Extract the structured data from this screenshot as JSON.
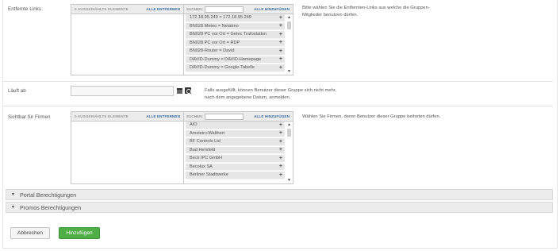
{
  "links": {
    "label": "Entfernte Links",
    "selected_count": "0 AUSGEWÄHLTE ELEMENTE",
    "remove_all": "ALLE ENTFERNEN",
    "search_label": "SUCHEN:",
    "search_value": "",
    "add_all": "ALLE HINZUFÜGEN",
    "items": [
      "172.18.95.249 = 172.18.95.249",
      "BN028 Meteo = Netatmo",
      "BN028 PC vor Ort = Getec Trafostation",
      "BN028 PC vor Ort = RDP",
      "BN028-Router = David",
      "DAVID-Dummy = DAVID-Homepage",
      "DAVID-Dummy = Google-Tabelle"
    ],
    "help_line1": "Bitte wählen Sie die Entfernten-Links aus welche die Gruppen-",
    "help_line2": "Mitglieder benutzen dürfen."
  },
  "expiry": {
    "label": "Läuft ab",
    "value": "",
    "help_line1": "Falls ausgefüllt, können Benutzer dieser Gruppe sich nicht mehr,",
    "help_line2": "nach dem angegebene Datum, anmelden."
  },
  "companies": {
    "label": "Sichtbar für Firmen",
    "selected_count": "0 AUSGEWÄHLTE ELEMENTE",
    "remove_all": "ALLE ENTFERNEN",
    "search_label": "SUCHEN:",
    "search_value": "",
    "add_all": "ALLE HINZUFÜGEN",
    "items": [
      "AIO",
      "Amstein+Walthert",
      "BF Controls Ltd",
      "Bad Hersfeld",
      "Beck IPC GmbH",
      "Becolux SA",
      "Berliner Stadtwerke"
    ],
    "help": "Wählen Sie Firmen, deren Benutzer dieser Gruppe beitreten dürfen."
  },
  "accordions": {
    "portal": "Portal Berechtigungen",
    "promos": "Promos Berechtigungen"
  },
  "buttons": {
    "cancel": "Abbrechen",
    "add": "Hinzufügen"
  },
  "icons": {
    "add_item": "plus-icon",
    "scroll_up": "chevron-up-icon",
    "scroll_down": "chevron-down-icon",
    "accordion": "caret-down-icon",
    "calendar": "calendar-icon",
    "clear_date": "clear-icon"
  },
  "colors": {
    "link": "#3a6ea8",
    "primary_button": "#4fae46",
    "accordion_bg": "#ececec",
    "item_bg": "#e6e6e6"
  }
}
